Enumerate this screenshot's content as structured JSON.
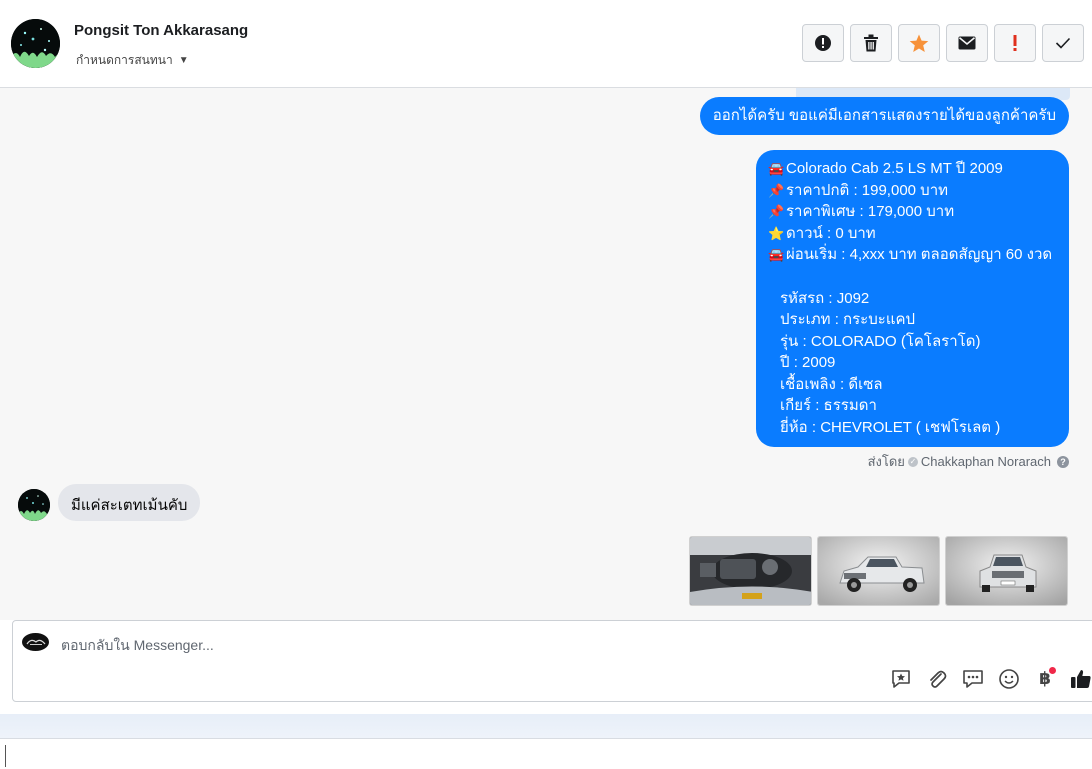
{
  "header": {
    "name": "Pongsit Ton Akkarasang",
    "assign_label": "กำหนดการสนทนา",
    "toolbar": [
      {
        "icon": "alert-circle-icon",
        "label": "Mark as spam"
      },
      {
        "icon": "trash-icon",
        "label": "Delete"
      },
      {
        "icon": "star-icon",
        "label": "Star"
      },
      {
        "icon": "envelope-icon",
        "label": "Mark as unread"
      },
      {
        "icon": "exclamation-icon",
        "label": "Follow up"
      },
      {
        "icon": "checkmark-icon",
        "label": "Mark as done"
      }
    ]
  },
  "thread": {
    "outgoing_1": "ออกได้ครับ ขอแค่มีเอกสารแสดงรายได้ของลูกค้าครับ",
    "listing": {
      "title": "Colorado Cab 2.5 LS MT ปี 2009",
      "normal_price": "ราคาปกติ : 199,000 บาท",
      "special_price": "ราคาพิเศษ : 179,000 บาท",
      "down": "ดาวน์ : 0 บาท",
      "installment": "ผ่อนเริ่ม : 4,xxx บาท ตลอดสัญญา 60 งวด",
      "code": "รหัสรถ : J092",
      "type": "ประเภท : กระบะแคป",
      "model": "รุ่น : COLORADO (โคโลราโด)",
      "year": "ปี : 2009",
      "fuel": "เชื้อเพลิง : ดีเซล",
      "gear": "เกียร์ : ธรรมดา",
      "brand": "ยี่ห้อ : CHEVROLET ( เชฟโรเลต )"
    },
    "sent_by_label": "ส่งโดย",
    "sent_by_name": "Chakkaphan Norarach",
    "incoming_1": "มีแค่สะเตทเม้นคับ",
    "photos": [
      "engine-bay-photo",
      "pickup-front-side-photo",
      "pickup-front-photo"
    ]
  },
  "composer": {
    "placeholder": "ตอบกลับใน Messenger...",
    "tools": [
      "saved-reply-icon",
      "paperclip-icon",
      "chat-bubbles-icon",
      "smiley-icon",
      "baht-icon",
      "thumbs-up-icon"
    ],
    "baht_symbol": "฿"
  }
}
